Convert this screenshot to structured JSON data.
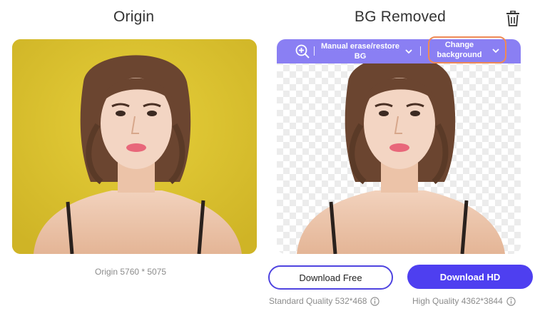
{
  "headings": {
    "origin": "Origin",
    "removed": "BG Removed"
  },
  "icons": {
    "delete": "trash-icon",
    "zoom": "zoom-in-icon",
    "dropdown": "chevron-down-icon",
    "info": "info-icon"
  },
  "toolbar": {
    "manual_label": "Manual erase/restore BG",
    "change_label": "Change background"
  },
  "original": {
    "caption": "Origin 5760 * 5075"
  },
  "downloads": {
    "free_label": "Download Free",
    "hd_label": "Download HD",
    "standard_quality": "Standard Quality 532*468",
    "high_quality": "High Quality 4362*3844"
  },
  "colors": {
    "accent": "#4e3ff0",
    "toolbar": "#8a7ff3",
    "highlight": "#ef8a55",
    "original_background": "#d9c12b"
  }
}
